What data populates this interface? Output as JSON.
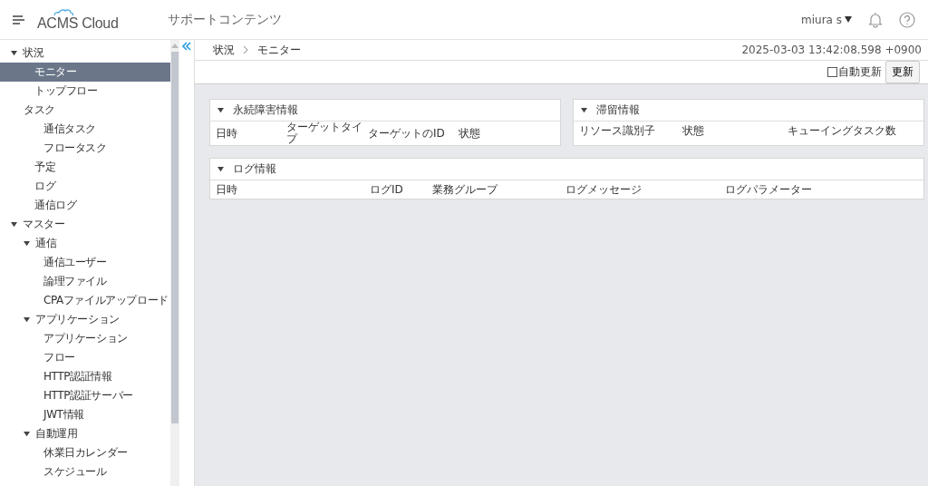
{
  "header": {
    "logo": "ACMS Cloud",
    "title": "サポートコンテンツ",
    "user": "miura s"
  },
  "sidebar": {
    "items": [
      {
        "label": "状況",
        "expanded": true,
        "selected": false,
        "children": [
          {
            "label": "モニター",
            "selected": true
          },
          {
            "label": "トップフロー",
            "selected": false
          },
          {
            "label": "タスク",
            "selected": false,
            "children": [
              {
                "label": "通信タスク",
                "selected": false
              },
              {
                "label": "フロータスク",
                "selected": false
              }
            ]
          },
          {
            "label": "予定",
            "selected": false
          },
          {
            "label": "ログ",
            "selected": false
          },
          {
            "label": "通信ログ",
            "selected": false
          }
        ]
      },
      {
        "label": "マスター",
        "expanded": true,
        "selected": false,
        "children": [
          {
            "label": "通信",
            "expanded": true,
            "selected": false,
            "children": [
              {
                "label": "通信ユーザー",
                "selected": false
              },
              {
                "label": "論理ファイル",
                "selected": false
              },
              {
                "label": "CPAファイルアップロード",
                "selected": false
              }
            ]
          },
          {
            "label": "アプリケーション",
            "expanded": true,
            "selected": false,
            "children": [
              {
                "label": "アプリケーション",
                "selected": false
              },
              {
                "label": "フロー",
                "selected": false
              },
              {
                "label": "HTTP認証情報",
                "selected": false
              },
              {
                "label": "HTTP認証サーバー",
                "selected": false
              },
              {
                "label": "JWT情報",
                "selected": false
              }
            ]
          },
          {
            "label": "自動運用",
            "expanded": true,
            "selected": false,
            "children": [
              {
                "label": "休業日カレンダー",
                "selected": false
              },
              {
                "label": "スケジュール",
                "selected": false
              }
            ]
          }
        ]
      }
    ]
  },
  "breadcrumb": [
    "状況",
    "モニター"
  ],
  "timestamp": "2025-03-03 13:42:08.598 +0900",
  "toolbar": {
    "auto_refresh": {
      "label": "自動更新",
      "checked": false
    },
    "refresh_button": "更新"
  },
  "panels": [
    {
      "title": "永続障害情報",
      "expanded": true,
      "columns": [
        "日時",
        "ターゲットタイプ",
        "ターゲットのID",
        "状態"
      ]
    },
    {
      "title": "滞留情報",
      "expanded": true,
      "columns": [
        "リソース識別子",
        "状態",
        "キューイングタスク数"
      ]
    },
    {
      "title": "ログ情報",
      "expanded": true,
      "columns": [
        "日時",
        "ログID",
        "業務グループ",
        "ログメッセージ",
        "ログパラメーター"
      ]
    }
  ]
}
